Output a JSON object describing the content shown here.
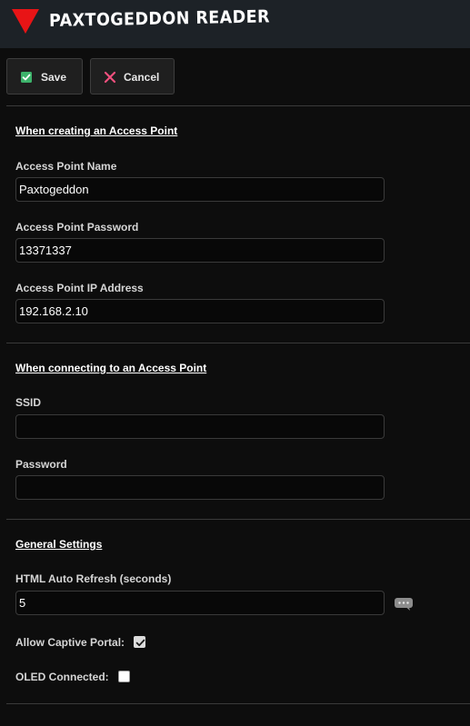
{
  "header": {
    "title": "PAXTOGEDDON READER"
  },
  "toolbar": {
    "save_label": "Save",
    "cancel_label": "Cancel"
  },
  "sections": {
    "access_point": {
      "title": "When creating an Access Point",
      "name_label": "Access Point Name",
      "name_value": "Paxtogeddon",
      "password_label": "Access Point Password",
      "password_value": "13371337",
      "ip_label": "Access Point IP Address",
      "ip_value": "192.168.2.10"
    },
    "connect": {
      "title": "When connecting to an Access Point",
      "ssid_label": "SSID",
      "ssid_value": "",
      "password_label": "Password",
      "password_value": ""
    },
    "general": {
      "title": "General Settings",
      "refresh_label": "HTML Auto Refresh (seconds)",
      "refresh_value": "5",
      "captive_label": "Allow Captive Portal:",
      "captive_checked": true,
      "oled_label": "OLED Connected:",
      "oled_checked": false
    }
  },
  "icons": {
    "logo": "red-triangle",
    "save": "checkbox-check-icon",
    "cancel": "x-icon",
    "help": "chat-bubble-icon"
  },
  "colors": {
    "brand_red": "#e81416",
    "save_green": "#3db36b",
    "cancel_pink": "#f0507e",
    "header_bg": "#1d2227",
    "page_bg": "#0d0d0d"
  }
}
